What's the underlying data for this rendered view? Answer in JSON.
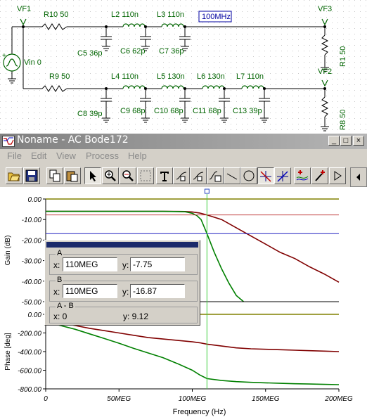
{
  "schematic": {
    "vf1": "VF1",
    "vf2": "VF2",
    "vf3": "VF3",
    "vin": "Vin 0",
    "r10": "R10 50",
    "r9": "R9 50",
    "r1": "R1 50",
    "r8": "R8 50",
    "l2": "L2 110n",
    "l3": "L3 110n",
    "l4": "L4 110n",
    "l5": "L5 130n",
    "l6": "L6 130n",
    "l7": "L7 110n",
    "c5": "C5 36p",
    "c6": "C6 62p",
    "c7": "C7 36p",
    "c8": "C8 39p",
    "c9": "C9 68p",
    "c10": "C10 68p",
    "c11": "C11 68p",
    "c13": "C13 39p",
    "freq_box": "100MHz"
  },
  "window": {
    "title": "Noname - AC Bode172",
    "minimize": "_",
    "maximize": "□",
    "close": "×"
  },
  "menu": [
    "File",
    "Edit",
    "View",
    "Process",
    "Help"
  ],
  "toolbar": [
    "open-icon",
    "save-icon",
    "copy-icon",
    "paste-icon",
    "pointer-icon",
    "zoom-in-icon",
    "zoom-out-icon",
    "zoom-100-icon",
    "text-icon",
    "cursor-a-icon",
    "cursor-b-icon",
    "curve-fit-icon",
    "line-icon",
    "circle-icon",
    "cursor-a-marker-icon",
    "cursor-b-marker-icon",
    "add-cursor-icon",
    "probe-icon",
    "play-icon"
  ],
  "cursor_panel": {
    "a_label": "A",
    "x_label": "x:",
    "y_label": "y:",
    "a_x": "110MEG",
    "a_y": "-7.75",
    "b_label": "B",
    "b_x": "110MEG",
    "b_y": "-16.87",
    "ab_label": "A - B",
    "ab_x": "x:  0",
    "ab_y": "y: 9.12"
  },
  "chart_data": [
    {
      "type": "line",
      "ylabel": "Gain (dB)",
      "xlim": [
        0,
        200
      ],
      "ylim": [
        -50,
        0
      ],
      "yticks": [
        "0.00",
        "-10.00",
        "-20.00",
        "-30.00",
        "-40.00",
        "-50.00"
      ],
      "series": [
        {
          "color": "#800000",
          "x": [
            0,
            10,
            20,
            40,
            60,
            80,
            95,
            100,
            105,
            110,
            120,
            130,
            140,
            150,
            160,
            170,
            180,
            190,
            200
          ],
          "y": [
            -6,
            -6,
            -6,
            -6,
            -6,
            -6,
            -6.1,
            -6.3,
            -6.8,
            -7.75,
            -10,
            -14,
            -18,
            -22,
            -26,
            -29,
            -33,
            -36.5,
            -40.5
          ]
        },
        {
          "color": "#008000",
          "x": [
            0,
            20,
            40,
            60,
            80,
            95,
            100,
            103,
            106,
            110,
            115,
            120,
            125,
            130,
            135
          ],
          "y": [
            -6,
            -6,
            -6,
            -6,
            -6,
            -6.2,
            -7,
            -8,
            -10,
            -16.87,
            -26,
            -34,
            -41,
            -47,
            -50
          ]
        }
      ]
    },
    {
      "type": "line",
      "xlabel": "Frequency (Hz)",
      "ylabel": "Phase [deg]",
      "xlim": [
        0,
        200
      ],
      "ylim": [
        -800,
        0
      ],
      "yticks": [
        "0.00",
        "-200.00",
        "-400.00",
        "-600.00",
        "-800.00"
      ],
      "xticks": [
        "0",
        "50MEG",
        "100MEG",
        "150MEG",
        "200MEG"
      ],
      "series": [
        {
          "color": "#800000",
          "x": [
            0,
            10,
            20,
            30,
            40,
            50,
            60,
            70,
            80,
            90,
            100,
            105,
            110,
            120,
            130,
            140,
            150,
            160,
            170,
            180,
            190,
            200
          ],
          "y": [
            -60,
            -90,
            -120,
            -150,
            -175,
            -200,
            -225,
            -250,
            -265,
            -280,
            -295,
            -305,
            -320,
            -340,
            -360,
            -370,
            -375,
            -380,
            -385,
            -390,
            -395,
            -400
          ]
        },
        {
          "color": "#008000",
          "x": [
            0,
            10,
            20,
            30,
            40,
            50,
            60,
            70,
            80,
            90,
            100,
            105,
            110,
            120,
            130,
            140,
            150,
            160,
            170,
            180,
            190,
            200
          ],
          "y": [
            -80,
            -120,
            -160,
            -210,
            -260,
            -310,
            -365,
            -415,
            -465,
            -530,
            -600,
            -650,
            -690,
            -710,
            -722,
            -730,
            -735,
            -740,
            -745,
            -748,
            -752,
            -755
          ]
        }
      ]
    }
  ]
}
